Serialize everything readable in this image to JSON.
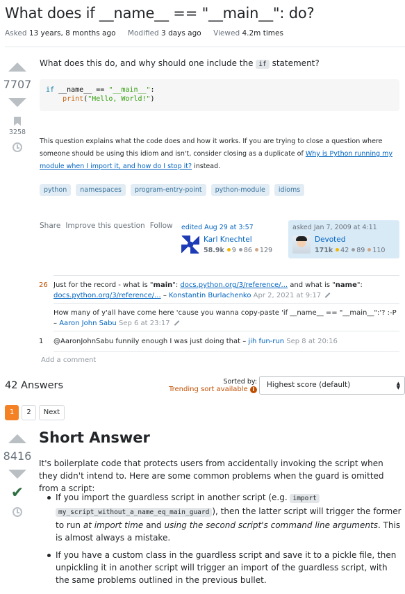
{
  "question": {
    "title": "What does if __name__ == \"__main__\": do?",
    "meta": {
      "asked_label": "Asked",
      "asked_value": "13 years, 8 months ago",
      "modified_label": "Modified",
      "modified_value": "3 days ago",
      "viewed_label": "Viewed",
      "viewed_value": "4.2m times"
    },
    "votes": "7707",
    "bookmarks": "3258",
    "body_pre": "What does this do, and why should one include the",
    "body_code": "if",
    "body_post": "statement?",
    "code": {
      "line1_kw": "if",
      "line1_mid": " __name__ == ",
      "line1_str": "\"__main__\"",
      "line1_end": ":",
      "line2_indent": "    ",
      "line2_fn": "print",
      "line2_open": "(",
      "line2_str": "\"Hello, World!\"",
      "line2_close": ")"
    },
    "note_text": "This question explains what the code does and how it works. If you are trying to close a question where someone should be using this idiom and isn't, consider closing as a duplicate of",
    "note_link": "Why is Python running my module when I import it, and how do I stop it?",
    "note_end": "instead.",
    "tags": [
      "python",
      "namespaces",
      "program-entry-point",
      "python-module",
      "idioms"
    ],
    "menu": {
      "share": "Share",
      "improve": "Improve this question",
      "follow": "Follow"
    },
    "editor": {
      "action": "edited Aug 29 at 3:57",
      "name": "Karl Knechtel",
      "rep": "58.9k",
      "gold": "9",
      "silver": "86",
      "bronze": "129"
    },
    "owner": {
      "action": "asked Jan 7, 2009 at 4:11",
      "name": "Devoted",
      "rep": "171k",
      "gold": "42",
      "silver": "89",
      "bronze": "110"
    }
  },
  "comments": [
    {
      "score": "26",
      "t1": "Just for the record - what is \"",
      "b1": "main",
      "t2": "\": ",
      "link1": "docs.python.org/3/reference/...",
      "t3": " and what is \"",
      "b2": "name",
      "t4": "\": ",
      "link2": "docs.python.org/3/reference/...",
      "sep": " – ",
      "user": "Konstantin Burlachenko",
      "date": "Apr 2, 2021 at 9:17"
    },
    {
      "score": "",
      "text": "How many of y'all have come here 'cause you wanna copy-paste 'if __name__ == \"__main__\":'? :-P",
      "sep": "– ",
      "user": "Aaron John Sabu",
      "date": "Sep 6 at 23:17"
    },
    {
      "score": "1",
      "text": "@AaronJohnSabu funnily enough I was just doing that",
      "sep": " – ",
      "user": "jih fun-run",
      "date": "Sep 8 at 20:16"
    }
  ],
  "add_comment": "Add a comment",
  "answers": {
    "count_label": "42 Answers",
    "sorted_by": "Sorted by:",
    "trending": "Trending sort available",
    "sort_value": "Highest score (default)",
    "pages": [
      "1",
      "2",
      "Next"
    ]
  },
  "answer": {
    "votes": "8416",
    "title": "Short Answer",
    "intro": "It's boilerplate code that protects users from accidentally invoking the script when they didn't intend to. Here are some common problems when the guard is omitted from a script:",
    "bullet1": {
      "t1": "If you import the guardless script in another script (e.g. ",
      "c1": "import",
      "c2": "my_script_without_a_name_eq_main_guard",
      "t2": "), then the latter script will trigger the former to run ",
      "e1": "at import time",
      "t3": " and ",
      "e2": "using the second script's command line arguments",
      "t4": ". This is almost always a mistake."
    },
    "bullet2": "If you have a custom class in the guardless script and save it to a pickle file, then unpickling it in another script will trigger an import of the guardless script, with the same problems outlined in the previous bullet."
  }
}
